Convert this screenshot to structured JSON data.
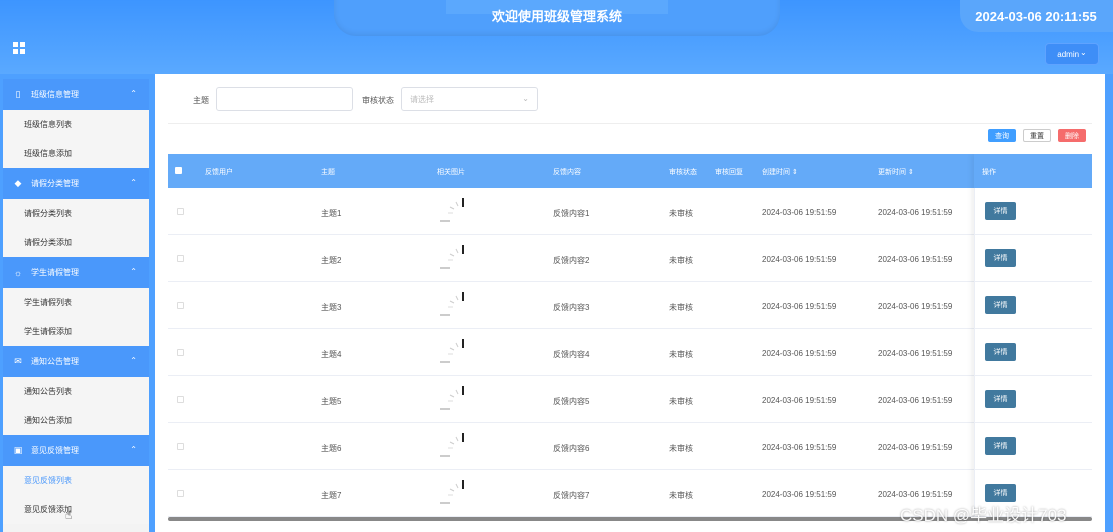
{
  "header": {
    "title": "欢迎使用班级管理系统",
    "datetime": "2024-03-06 20:11:55",
    "user_label": "admin",
    "user_chevron": "⌄"
  },
  "sidebar": {
    "groups": [
      {
        "label": "班级信息管理",
        "icon": "bookmark-icon",
        "items": [
          "班级信息列表",
          "班级信息添加"
        ]
      },
      {
        "label": "请假分类管理",
        "icon": "tag-icon",
        "items": [
          "请假分类列表",
          "请假分类添加"
        ]
      },
      {
        "label": "学生请假管理",
        "icon": "sun-icon",
        "items": [
          "学生请假列表",
          "学生请假添加"
        ]
      },
      {
        "label": "通知公告管理",
        "icon": "mail-icon",
        "items": [
          "通知公告列表",
          "通知公告添加"
        ]
      },
      {
        "label": "意见反馈管理",
        "icon": "clipboard-icon",
        "items": [
          "意见反馈列表",
          "意见反馈添加"
        ],
        "active_item": 0
      }
    ]
  },
  "search": {
    "subject_label": "主题",
    "subject_value": "",
    "status_label": "审核状态",
    "status_placeholder": "请选择"
  },
  "actions": {
    "query": "查询",
    "reset": "重置",
    "delete": "删除"
  },
  "table": {
    "columns": [
      "反馈用户",
      "主题",
      "相关图片",
      "反馈内容",
      "审核状态",
      "审核回复",
      "创建时间 ⇕",
      "更新时间 ⇕",
      "操作"
    ],
    "detail_label": "详情",
    "rows": [
      {
        "user": "",
        "subject": "主题1",
        "content": "反馈内容1",
        "status": "未审核",
        "reply": "",
        "created": "2024-03-06 19:51:59",
        "updated": "2024-03-06 19:51:59"
      },
      {
        "user": "",
        "subject": "主题2",
        "content": "反馈内容2",
        "status": "未审核",
        "reply": "",
        "created": "2024-03-06 19:51:59",
        "updated": "2024-03-06 19:51:59"
      },
      {
        "user": "",
        "subject": "主题3",
        "content": "反馈内容3",
        "status": "未审核",
        "reply": "",
        "created": "2024-03-06 19:51:59",
        "updated": "2024-03-06 19:51:59"
      },
      {
        "user": "",
        "subject": "主题4",
        "content": "反馈内容4",
        "status": "未审核",
        "reply": "",
        "created": "2024-03-06 19:51:59",
        "updated": "2024-03-06 19:51:59"
      },
      {
        "user": "",
        "subject": "主题5",
        "content": "反馈内容5",
        "status": "未审核",
        "reply": "",
        "created": "2024-03-06 19:51:59",
        "updated": "2024-03-06 19:51:59"
      },
      {
        "user": "",
        "subject": "主题6",
        "content": "反馈内容6",
        "status": "未审核",
        "reply": "",
        "created": "2024-03-06 19:51:59",
        "updated": "2024-03-06 19:51:59"
      },
      {
        "user": "",
        "subject": "主题7",
        "content": "反馈内容7",
        "status": "未审核",
        "reply": "",
        "created": "2024-03-06 19:51:59",
        "updated": "2024-03-06 19:51:59"
      }
    ]
  },
  "watermark": "CSDN @毕业设计703",
  "colors": {
    "header": "#4ea0ff",
    "sidebar_group": "#4a98fb",
    "table_head": "#64aaf8",
    "detail_button": "#41799e",
    "delete_button": "#f56c6c",
    "query_button": "#409eff"
  }
}
